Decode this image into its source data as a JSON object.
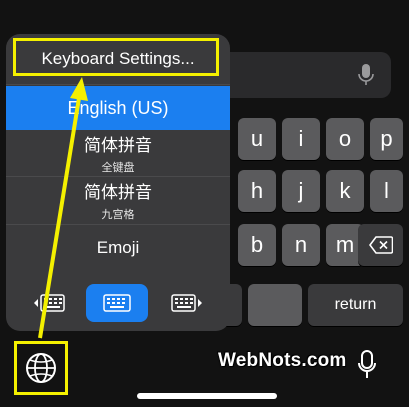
{
  "keyboard_menu": {
    "settings_label": "Keyboard Settings...",
    "languages": [
      {
        "label": "English (US)",
        "selected": true
      },
      {
        "label": "简体拼音",
        "sublabel": "全键盘"
      },
      {
        "label": "简体拼音",
        "sublabel": "九宫格"
      },
      {
        "label": "Emoji"
      }
    ],
    "layout_options": [
      "left-handed-keyboard-icon",
      "full-keyboard-icon",
      "right-handed-keyboard-icon"
    ]
  },
  "keys": {
    "row1": [
      "u",
      "i",
      "o",
      "p"
    ],
    "row2": [
      "h",
      "j",
      "k",
      "l"
    ],
    "row3": [
      "b",
      "n",
      "m"
    ],
    "return_label": "return",
    "delete_icon": "delete-icon"
  },
  "watermark": "WebNots.com",
  "colors": {
    "selection": "#1b7ff0",
    "highlight": "#f4f000",
    "key": "#5b5b5d"
  }
}
